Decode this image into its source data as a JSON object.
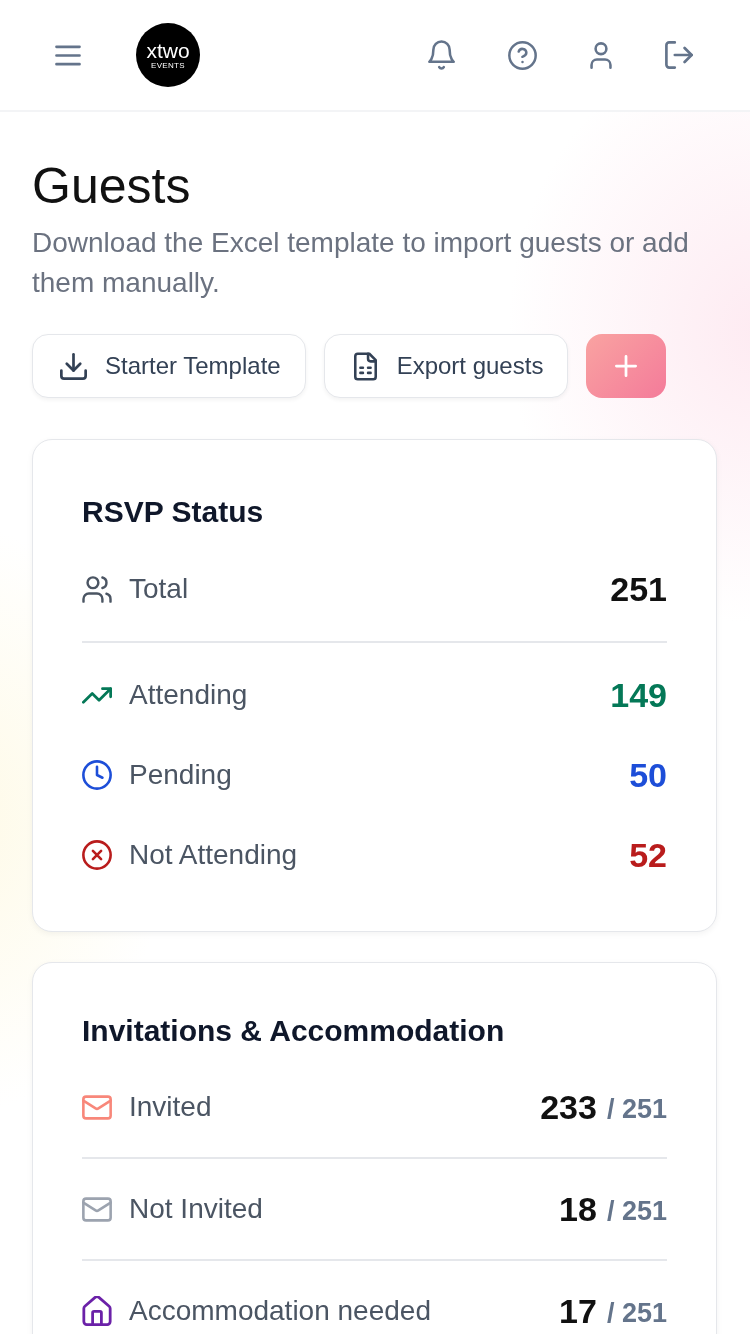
{
  "header": {
    "logo": {
      "name": "xtwo",
      "tagline": "EVENTS"
    }
  },
  "page": {
    "title": "Guests",
    "subtitle": "Download the Excel template to import guests or add them manually."
  },
  "actions": [
    {
      "kind": "download",
      "label": "Starter Template"
    },
    {
      "kind": "export",
      "label": "Export guests"
    },
    {
      "kind": "add"
    }
  ],
  "rsvp_card": {
    "title": "RSVP Status",
    "total": {
      "label": "Total",
      "value": "251"
    },
    "rows": [
      {
        "kind": "attending",
        "label": "Attending",
        "value": "149",
        "color": "#047857"
      },
      {
        "kind": "pending",
        "label": "Pending",
        "value": "50",
        "color": "#1d4ed8"
      },
      {
        "kind": "declined",
        "label": "Not Attending",
        "value": "52",
        "color": "#b91c1c"
      }
    ]
  },
  "invitations_card": {
    "title": "Invitations & Accommodation",
    "rows": [
      {
        "kind": "invited",
        "label": "Invited",
        "value": "233",
        "total": "/ 251"
      },
      {
        "kind": "not_invited",
        "label": "Not Invited",
        "value": "18",
        "total": "/ 251"
      },
      {
        "kind": "accommodation",
        "label": "Accommodation needed",
        "value": "17",
        "total": "/ 251"
      }
    ]
  }
}
